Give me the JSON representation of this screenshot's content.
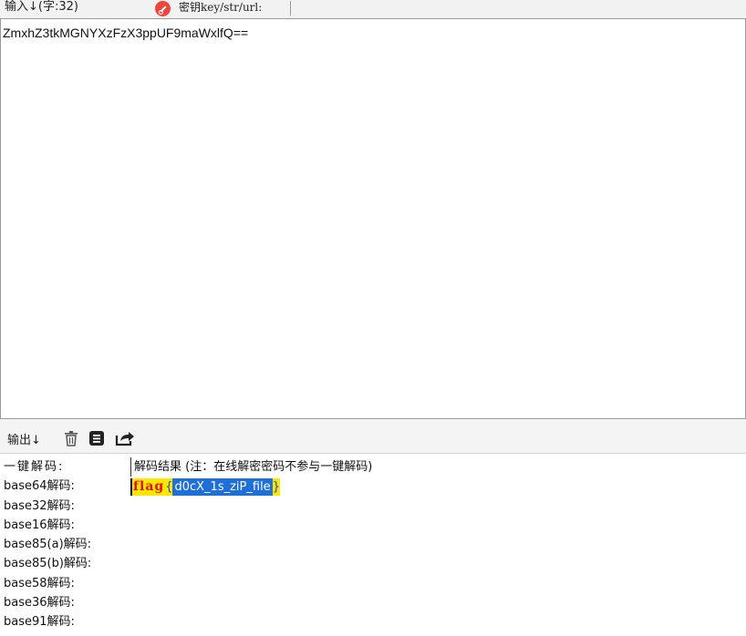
{
  "header": {
    "input_label": "输入↓(字:32)",
    "key_label": "密钥key/str/url:",
    "key_value": ""
  },
  "input": {
    "text": "ZmxhZ3tkMGNYXzFzX3ppUF9maWxlfQ=="
  },
  "output_bar": {
    "label": "输出↓",
    "icons": [
      "trash-icon",
      "copy-icon",
      "share-icon"
    ]
  },
  "decode": {
    "labels": [
      "一键解码:",
      "base64解码:",
      "base32解码:",
      "base16解码:",
      "base85(a)解码:",
      "base85(b)解码:",
      "base58解码:",
      "base36解码:",
      "base91解码:"
    ],
    "result_header": "解码结果 (注：在线解密密码不参与一键解码)",
    "base64_result": {
      "prefix": "flag",
      "brace_open": "{",
      "body": "d0cX_1s_ziP_file",
      "brace_close": "}"
    }
  },
  "colors": {
    "highlight_yellow": "#ffe600",
    "flag_red": "#e01010",
    "selection_blue": "#1f6fd8",
    "key_icon_red": "#f0453b"
  }
}
